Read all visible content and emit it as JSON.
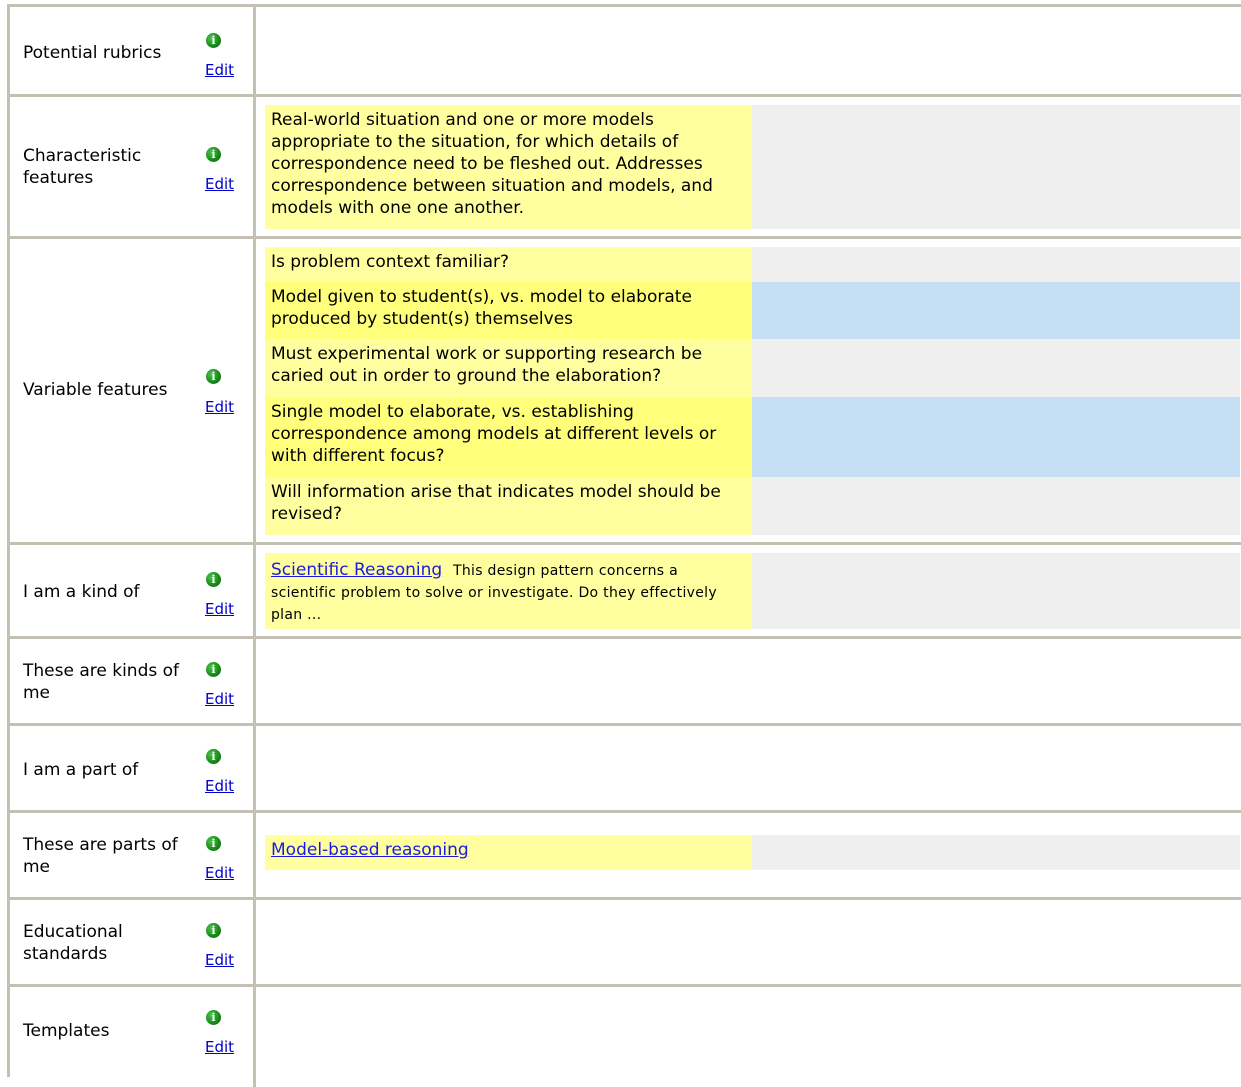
{
  "edit_label": "Edit",
  "info_glyph": "i",
  "rows": {
    "potential_rubrics": {
      "label": "Potential rubrics"
    },
    "characteristic_features": {
      "label": "Characteristic features",
      "items": [
        "Real-world situation and one or more models appropriate to the situation, for which details of correspondence need to be fleshed out. Addresses correspondence between situation and models, and models with one one another."
      ]
    },
    "variable_features": {
      "label": "Variable features",
      "items": [
        "Is problem context familiar?",
        "Model given to student(s), vs. model to elaborate produced by student(s) themselves",
        "Must experimental work or supporting research be caried out in order to ground the elaboration?",
        "Single model to elaborate, vs. establishing correspondence among models at different levels or with different focus?",
        "Will information arise that indicates model should be revised?"
      ]
    },
    "kind_of": {
      "label": "I am a kind of",
      "link_text": "Scientific Reasoning",
      "description": "This design pattern concerns a scientific problem to solve or investigate. Do they effectively plan ..."
    },
    "kinds_of_me": {
      "label": "These are kinds of me"
    },
    "part_of": {
      "label": "I am a part of"
    },
    "parts_of_me": {
      "label": "These are parts of me",
      "link_text": "Model-based reasoning"
    },
    "educational_standards": {
      "label": "Educational standards"
    },
    "templates": {
      "label": "Templates"
    }
  },
  "colors": {
    "border": "#c4c0b4",
    "yellow_light": "#ffffa0",
    "yellow_dark": "#ffff7c",
    "grey_side": "#efefef",
    "blue_side": "#c6dff5",
    "info_icon": "#1a8c1a",
    "link": "#1a1ae6"
  },
  "icons": {
    "info": "info-icon"
  }
}
